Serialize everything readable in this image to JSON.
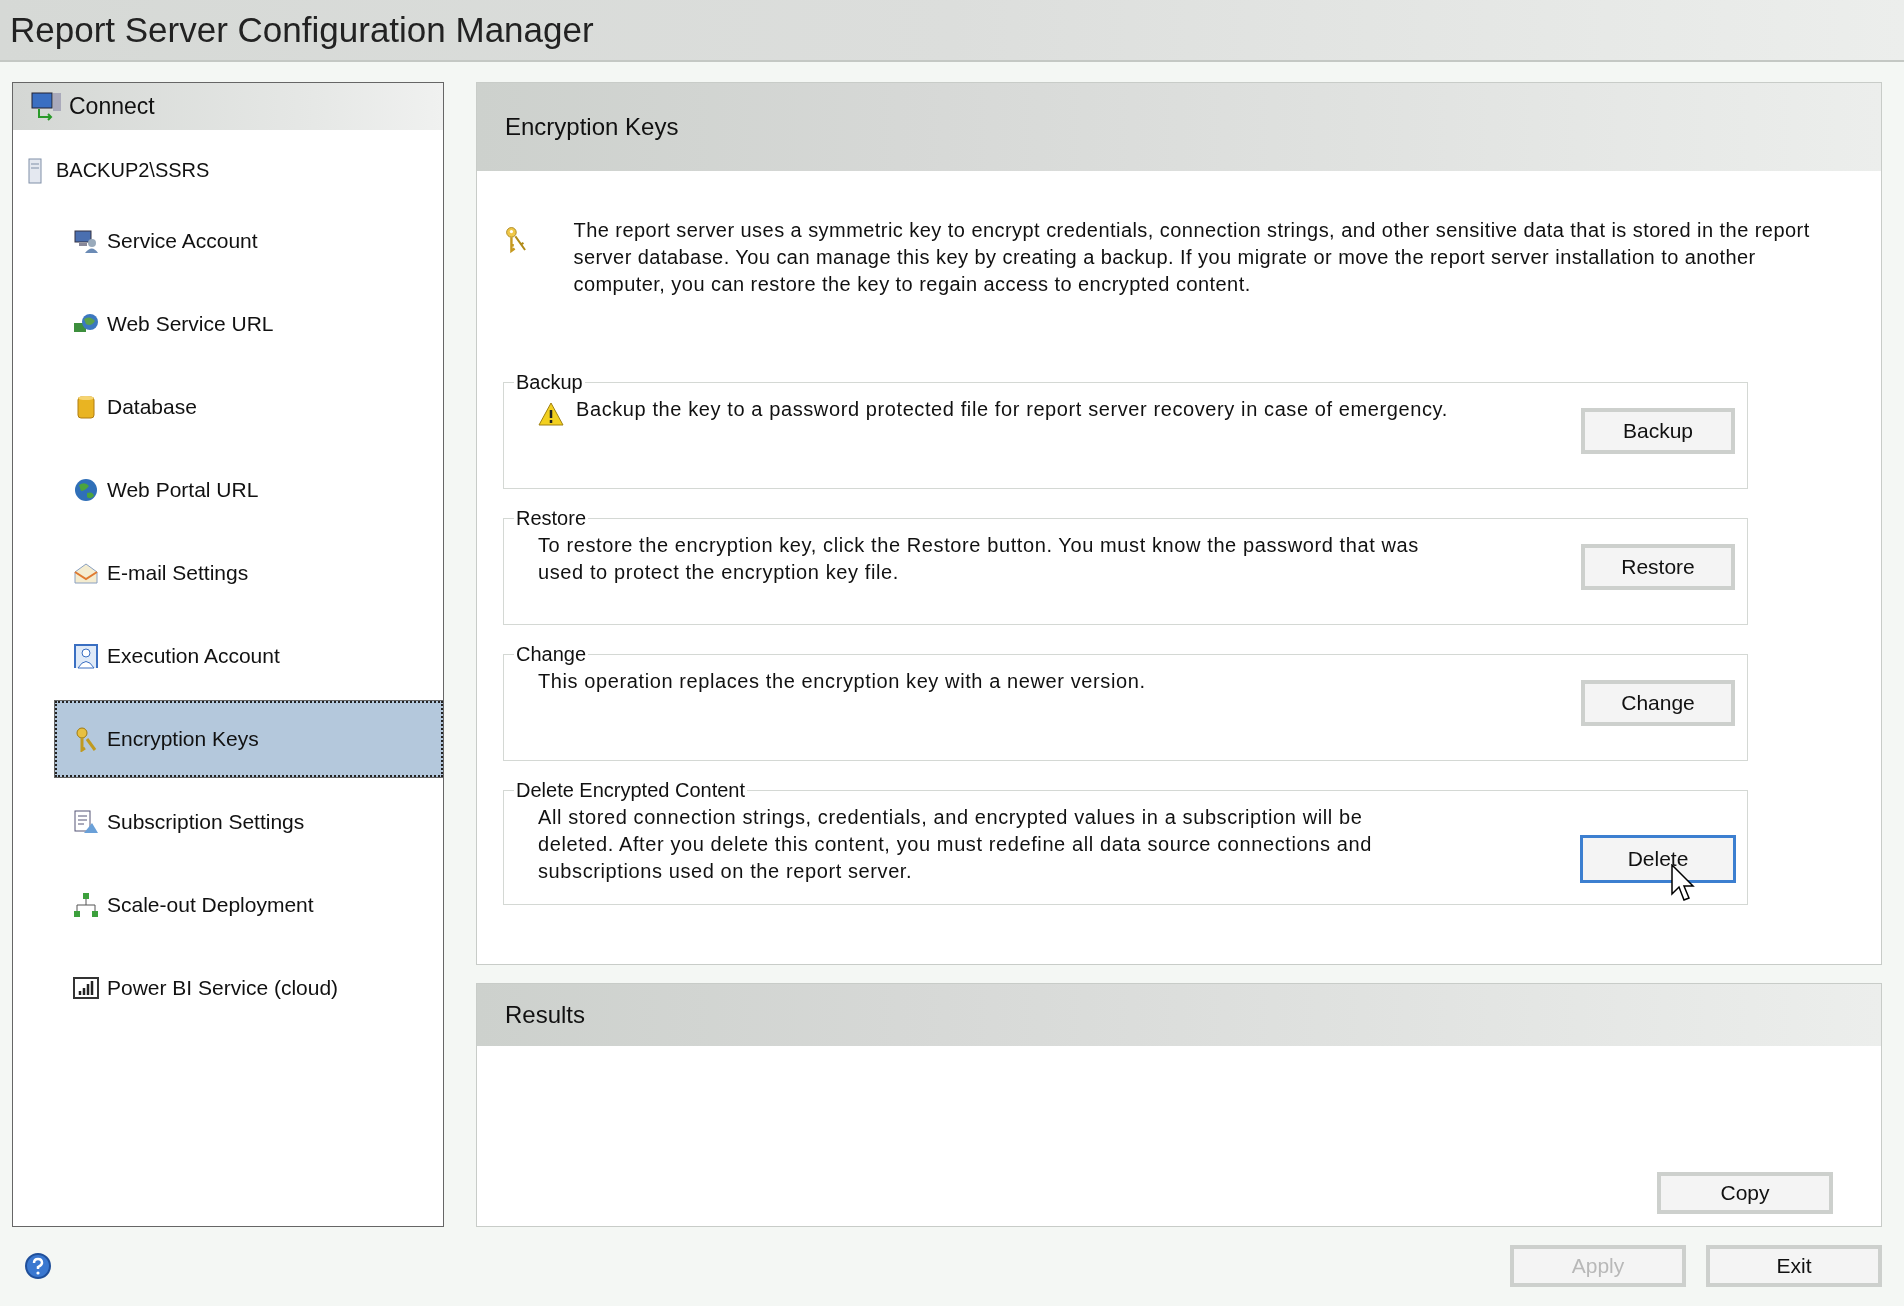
{
  "window": {
    "title": "Report Server Configuration Manager"
  },
  "sidebar": {
    "connect": "Connect",
    "server": "BACKUP2\\SSRS",
    "items": [
      {
        "label": "Service Account",
        "kind": "account",
        "selected": false
      },
      {
        "label": "Web Service URL",
        "kind": "webservice",
        "selected": false
      },
      {
        "label": "Database",
        "kind": "database",
        "selected": false
      },
      {
        "label": "Web Portal URL",
        "kind": "globe",
        "selected": false
      },
      {
        "label": "E-mail Settings",
        "kind": "mail",
        "selected": false
      },
      {
        "label": "Execution Account",
        "kind": "person",
        "selected": false
      },
      {
        "label": "Encryption Keys",
        "kind": "keys",
        "selected": true
      },
      {
        "label": "Subscription Settings",
        "kind": "subscription",
        "selected": false
      },
      {
        "label": "Scale-out Deployment",
        "kind": "network",
        "selected": false
      },
      {
        "label": "Power BI Service (cloud)",
        "kind": "chart",
        "selected": false
      }
    ]
  },
  "page": {
    "title": "Encryption Keys",
    "description": "The report server uses a symmetric key to encrypt credentials, connection strings, and other sensitive data that is stored in the report server database.  You can manage this key by creating a backup.  If you migrate or move the report server installation to another computer, you can restore the key to regain access to encrypted content.",
    "sections": [
      {
        "legend": "Backup",
        "text": "Backup the key to a password protected file for report server recovery in case of emergency.",
        "warning": true,
        "button": {
          "label": "Backup",
          "focused": false,
          "pointer": false
        }
      },
      {
        "legend": "Restore",
        "text": "To restore the encryption key, click the Restore button.  You must know the password that was used to protect the encryption key file.",
        "warning": false,
        "button": {
          "label": "Restore",
          "focused": false,
          "pointer": false
        }
      },
      {
        "legend": "Change",
        "text": "This operation replaces the encryption key with a newer version.",
        "warning": false,
        "button": {
          "label": "Change",
          "focused": false,
          "pointer": false
        }
      },
      {
        "legend": "Delete Encrypted Content",
        "text": "All stored connection strings, credentials, and encrypted values in a subscription will be deleted.  After you delete this content, you must redefine all data source connections and subscriptions used on the report server.",
        "warning": false,
        "button": {
          "label": "Delete",
          "focused": true,
          "pointer": true
        }
      }
    ]
  },
  "results": {
    "title": "Results",
    "copy_button": {
      "label": "Copy",
      "disabled": false
    }
  },
  "footer": {
    "buttons": [
      {
        "label": "Apply",
        "disabled": true
      },
      {
        "label": "Exit",
        "disabled": false
      }
    ]
  }
}
